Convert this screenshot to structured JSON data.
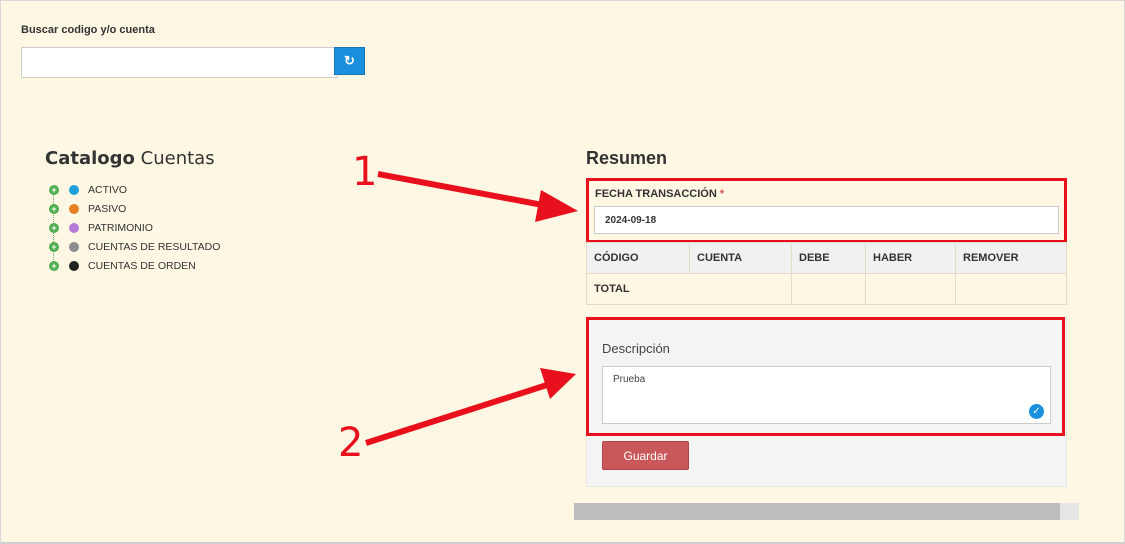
{
  "search": {
    "label": "Buscar codigo y/o cuenta",
    "value": "",
    "refresh_icon": "refresh-icon"
  },
  "catalog": {
    "title_bold": "Catalogo",
    "title_rest": "Cuentas",
    "items": [
      {
        "label": "ACTIVO",
        "color": "#1e9fe0"
      },
      {
        "label": "PASIVO",
        "color": "#e67e22"
      },
      {
        "label": "PATRIMONIO",
        "color": "#b57ad6"
      },
      {
        "label": "CUENTAS DE RESULTADO",
        "color": "#8c8c8c"
      },
      {
        "label": "CUENTAS DE ORDEN",
        "color": "#222222"
      }
    ]
  },
  "resumen": {
    "title": "Resumen",
    "fecha_label": "FECHA TRANSACCIÓN",
    "required_mark": "*",
    "fecha_value": "2024-09-18",
    "columns": [
      "CÓDIGO",
      "CUENTA",
      "DEBE",
      "HABER",
      "REMOVER"
    ],
    "total_label": "TOTAL"
  },
  "descripcion": {
    "label": "Descripción",
    "value": "Prueba"
  },
  "save_label": "Guardar",
  "annotations": {
    "one": "1",
    "two": "2"
  },
  "colors": {
    "accent": "#1a8fdd",
    "highlight": "#e8101c",
    "save": "#c9585a",
    "background": "#fdf7e3"
  }
}
